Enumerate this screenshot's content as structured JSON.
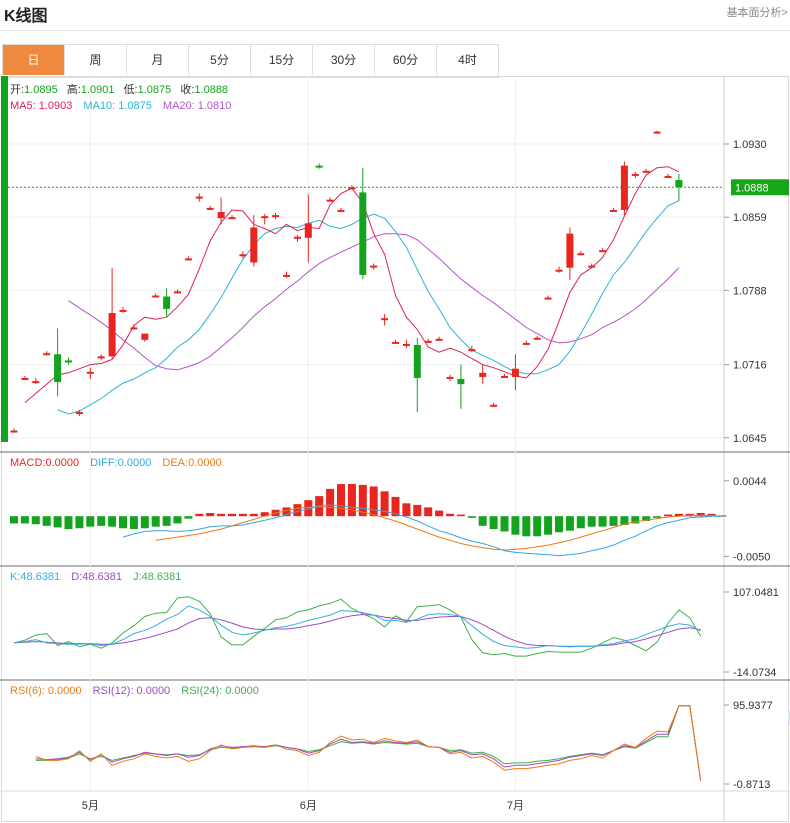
{
  "header": {
    "title": "K线图",
    "link": "基本面分析>"
  },
  "tabs": [
    "日",
    "周",
    "月",
    "5分",
    "15分",
    "30分",
    "60分",
    "4时"
  ],
  "active_tab": 0,
  "colors": {
    "up": "#e8251e",
    "down": "#14a31e",
    "ma5": "#e0205a",
    "ma10": "#2ab4d8",
    "ma20": "#b255c8",
    "diff": "#33a8e0",
    "dea": "#ee7a16",
    "k": "#35aee0",
    "d": "#9a4ec0",
    "j": "#3fb04a",
    "rsi6": "#ee7a16",
    "rsi12": "#9a4ec0",
    "rsi24": "#3fb04a",
    "current": "#19a519"
  },
  "info": {
    "open_label": "开:",
    "open": "1.0895",
    "high_label": "高:",
    "high": "1.0901",
    "low_label": "低:",
    "low": "1.0875",
    "close_label": "收:",
    "close": "1.0888",
    "ma5_label": "MA5:",
    "ma5": "1.0903",
    "ma10_label": "MA10:",
    "ma10": "1.0875",
    "ma20_label": "MA20:",
    "ma20": "1.0810"
  },
  "current_price": "1.0888",
  "macd_legend": {
    "macd_label": "MACD:",
    "macd": "0.0000",
    "diff_label": "DIFF:",
    "diff": "0.0000",
    "dea_label": "DEA:",
    "dea": "0.0000"
  },
  "kdj_legend": {
    "k_label": "K:",
    "k": "48.6381",
    "d_label": "D:",
    "d": "48.6381",
    "j_label": "J:",
    "j": "48.6381"
  },
  "rsi_legend": {
    "rsi6_label": "RSI(6):",
    "rsi6": "0.0000",
    "rsi12_label": "RSI(12):",
    "rsi12": "0.0000",
    "rsi24_label": "RSI(24):",
    "rsi24": "0.0000"
  },
  "chart_data": [
    {
      "type": "candlestick",
      "title": "K线图",
      "y_ticks": [
        "1.0930",
        "1.0859",
        "1.0788",
        "1.0716",
        "1.0645"
      ],
      "ylim": [
        1.0637,
        1.0962
      ],
      "x_ticks": [
        {
          "label": "5月",
          "index": 7
        },
        {
          "label": "6月",
          "index": 27
        },
        {
          "label": "7月",
          "index": 46
        }
      ],
      "candles": [
        {
          "o": 1.0652,
          "h": 1.0654,
          "l": 1.065,
          "c": 1.0652
        },
        {
          "o": 1.0703,
          "h": 1.0705,
          "l": 1.0701,
          "c": 1.0703
        },
        {
          "o": 1.07,
          "h": 1.0703,
          "l": 1.0697,
          "c": 1.07
        },
        {
          "o": 1.0727,
          "h": 1.0729,
          "l": 1.0725,
          "c": 1.0727
        },
        {
          "o": 1.0726,
          "h": 1.0751,
          "l": 1.0685,
          "c": 1.0699
        },
        {
          "o": 1.072,
          "h": 1.0723,
          "l": 1.0716,
          "c": 1.0719
        },
        {
          "o": 1.0668,
          "h": 1.0672,
          "l": 1.0666,
          "c": 1.067
        },
        {
          "o": 1.0708,
          "h": 1.0713,
          "l": 1.0702,
          "c": 1.0709
        },
        {
          "o": 1.0722,
          "h": 1.0726,
          "l": 1.072,
          "c": 1.0724
        },
        {
          "o": 1.0724,
          "h": 1.081,
          "l": 1.0722,
          "c": 1.0766
        },
        {
          "o": 1.0769,
          "h": 1.0772,
          "l": 1.0766,
          "c": 1.0769
        },
        {
          "o": 1.0752,
          "h": 1.0755,
          "l": 1.075,
          "c": 1.0752
        },
        {
          "o": 1.074,
          "h": 1.0746,
          "l": 1.0738,
          "c": 1.0746
        },
        {
          "o": 1.0783,
          "h": 1.0785,
          "l": 1.0781,
          "c": 1.0783
        },
        {
          "o": 1.0782,
          "h": 1.079,
          "l": 1.0762,
          "c": 1.077
        },
        {
          "o": 1.0787,
          "h": 1.0789,
          "l": 1.0785,
          "c": 1.0787
        },
        {
          "o": 1.0819,
          "h": 1.0821,
          "l": 1.0817,
          "c": 1.0819
        },
        {
          "o": 1.0879,
          "h": 1.0882,
          "l": 1.0874,
          "c": 1.0879
        },
        {
          "o": 1.0868,
          "h": 1.087,
          "l": 1.0866,
          "c": 1.0868
        },
        {
          "o": 1.0858,
          "h": 1.0878,
          "l": 1.0852,
          "c": 1.0864
        },
        {
          "o": 1.0859,
          "h": 1.0861,
          "l": 1.0857,
          "c": 1.0859
        },
        {
          "o": 1.0823,
          "h": 1.0826,
          "l": 1.0819,
          "c": 1.0823
        },
        {
          "o": 1.0815,
          "h": 1.0861,
          "l": 1.0811,
          "c": 1.0849
        },
        {
          "o": 1.0859,
          "h": 1.0862,
          "l": 1.0852,
          "c": 1.086
        },
        {
          "o": 1.086,
          "h": 1.0863,
          "l": 1.0857,
          "c": 1.0861
        },
        {
          "o": 1.0803,
          "h": 1.0806,
          "l": 1.08,
          "c": 1.0803
        },
        {
          "o": 1.0838,
          "h": 1.0842,
          "l": 1.0835,
          "c": 1.084
        },
        {
          "o": 1.0839,
          "h": 1.0881,
          "l": 1.0815,
          "c": 1.0853
        },
        {
          "o": 1.0909,
          "h": 1.0911,
          "l": 1.0906,
          "c": 1.0908
        },
        {
          "o": 1.0876,
          "h": 1.0878,
          "l": 1.0874,
          "c": 1.0876
        },
        {
          "o": 1.0866,
          "h": 1.0868,
          "l": 1.0864,
          "c": 1.0866
        },
        {
          "o": 1.0888,
          "h": 1.089,
          "l": 1.0886,
          "c": 1.0888
        },
        {
          "o": 1.0883,
          "h": 1.0907,
          "l": 1.0799,
          "c": 1.0803
        },
        {
          "o": 1.0812,
          "h": 1.0814,
          "l": 1.0808,
          "c": 1.0812
        },
        {
          "o": 1.0761,
          "h": 1.0765,
          "l": 1.0754,
          "c": 1.0761
        },
        {
          "o": 1.0738,
          "h": 1.074,
          "l": 1.0736,
          "c": 1.0738
        },
        {
          "o": 1.0736,
          "h": 1.074,
          "l": 1.0732,
          "c": 1.0736
        },
        {
          "o": 1.0735,
          "h": 1.0742,
          "l": 1.067,
          "c": 1.0703
        },
        {
          "o": 1.0739,
          "h": 1.0741,
          "l": 1.0737,
          "c": 1.0739
        },
        {
          "o": 1.0741,
          "h": 1.0743,
          "l": 1.0739,
          "c": 1.0741
        },
        {
          "o": 1.0703,
          "h": 1.0706,
          "l": 1.07,
          "c": 1.0704
        },
        {
          "o": 1.0702,
          "h": 1.0716,
          "l": 1.0673,
          "c": 1.0697
        },
        {
          "o": 1.0731,
          "h": 1.0734,
          "l": 1.0728,
          "c": 1.0731
        },
        {
          "o": 1.0704,
          "h": 1.0716,
          "l": 1.0697,
          "c": 1.0708
        },
        {
          "o": 1.0677,
          "h": 1.0679,
          "l": 1.0675,
          "c": 1.0677
        },
        {
          "o": 1.0705,
          "h": 1.0707,
          "l": 1.0703,
          "c": 1.0705
        },
        {
          "o": 1.0704,
          "h": 1.0726,
          "l": 1.0691,
          "c": 1.0712
        },
        {
          "o": 1.0737,
          "h": 1.0739,
          "l": 1.0735,
          "c": 1.0737
        },
        {
          "o": 1.0742,
          "h": 1.0744,
          "l": 1.074,
          "c": 1.0742
        },
        {
          "o": 1.0781,
          "h": 1.0783,
          "l": 1.0779,
          "c": 1.0781
        },
        {
          "o": 1.0808,
          "h": 1.0811,
          "l": 1.0805,
          "c": 1.0808
        },
        {
          "o": 1.081,
          "h": 1.0849,
          "l": 1.0798,
          "c": 1.0843
        },
        {
          "o": 1.0824,
          "h": 1.0826,
          "l": 1.0822,
          "c": 1.0824
        },
        {
          "o": 1.0812,
          "h": 1.0814,
          "l": 1.081,
          "c": 1.0812
        },
        {
          "o": 1.0827,
          "h": 1.0829,
          "l": 1.0825,
          "c": 1.0827
        },
        {
          "o": 1.0866,
          "h": 1.0868,
          "l": 1.0864,
          "c": 1.0866
        },
        {
          "o": 1.0866,
          "h": 1.0913,
          "l": 1.0861,
          "c": 1.0909
        },
        {
          "o": 1.0901,
          "h": 1.0903,
          "l": 1.0897,
          "c": 1.0901
        },
        {
          "o": 1.0904,
          "h": 1.0906,
          "l": 1.0902,
          "c": 1.0904
        },
        {
          "o": 1.0942,
          "h": 1.0943,
          "l": 1.094,
          "c": 1.0942
        },
        {
          "o": 1.0899,
          "h": 1.0901,
          "l": 1.0897,
          "c": 1.0899
        },
        {
          "o": 1.0895,
          "h": 1.0901,
          "l": 1.0875,
          "c": 1.0888
        }
      ],
      "ma5": [
        1.0679,
        1.0688,
        1.0697,
        1.0706,
        1.0708,
        1.0712,
        1.0716,
        1.0717,
        1.0721,
        1.0735,
        1.0754,
        1.0762,
        1.076,
        1.0762,
        1.0772,
        1.0784,
        1.0809,
        1.0836,
        1.0854,
        1.0866,
        1.0865,
        1.0852,
        1.0848,
        1.0843,
        1.0852,
        1.0846,
        1.0849,
        1.0848,
        1.0871,
        1.0882,
        1.0887,
        1.0873,
        1.0843,
        1.0823,
        1.0783,
        1.0762,
        1.075,
        1.0733,
        1.0728,
        1.0732,
        1.0728,
        1.0722,
        1.0716,
        1.0713,
        1.0709,
        1.0705,
        1.0703,
        1.0714,
        1.0731,
        1.0758,
        1.0786,
        1.0803,
        1.081,
        1.082,
        1.0837,
        1.086,
        1.0882,
        1.09,
        1.0907,
        1.0908,
        1.0903
      ],
      "ma10": [
        1.0672,
        1.0668,
        1.0671,
        1.0677,
        1.0683,
        1.0691,
        1.0698,
        1.0702,
        1.0708,
        1.0713,
        1.0722,
        1.0733,
        1.074,
        1.075,
        1.0765,
        1.0781,
        1.08,
        1.0818,
        1.0832,
        1.0843,
        1.0848,
        1.085,
        1.0849,
        1.0853,
        1.0856,
        1.085,
        1.0848,
        1.0852,
        1.0858,
        1.0862,
        1.0858,
        1.0845,
        1.083,
        1.0808,
        1.0787,
        1.077,
        1.0752,
        1.074,
        1.073,
        1.0725,
        1.072,
        1.0714,
        1.0709,
        1.0707,
        1.0707,
        1.0711,
        1.0716,
        1.0729,
        1.0746,
        1.0765,
        1.0785,
        1.0803,
        1.0815,
        1.083,
        1.0845,
        1.0858,
        1.087,
        1.0875
      ],
      "ma20": [
        1.0778,
        1.0771,
        1.0764,
        1.0757,
        1.0749,
        1.074,
        1.0732,
        1.0723,
        1.0715,
        1.0712,
        1.0711,
        1.0714,
        1.0718,
        1.0724,
        1.0733,
        1.0742,
        1.0752,
        1.0763,
        1.0772,
        1.078,
        1.0789,
        1.0797,
        1.0806,
        1.0814,
        1.082,
        1.0825,
        1.083,
        1.0835,
        1.084,
        1.0843,
        1.0843,
        1.0842,
        1.0837,
        1.0828,
        1.0819,
        1.0809,
        1.0799,
        1.0791,
        1.0783,
        1.0776,
        1.0768,
        1.076,
        1.0752,
        1.0746,
        1.074,
        1.0737,
        1.0738,
        1.0741,
        1.0745,
        1.0752,
        1.0757,
        1.0763,
        1.077,
        1.0779,
        1.0789,
        1.0799,
        1.081
      ]
    },
    {
      "type": "macd",
      "y_ticks": [
        "0.0044",
        "-0.0050"
      ],
      "ylim": [
        -0.0052,
        0.0055
      ],
      "macd": [
        -0.0009,
        -0.0009,
        -0.001,
        -0.0012,
        -0.0014,
        -0.0016,
        -0.0015,
        -0.0013,
        -0.0012,
        -0.0013,
        -0.0015,
        -0.0016,
        -0.0015,
        -0.0013,
        -0.0012,
        -0.0009,
        -0.0003,
        0.0003,
        0.0004,
        0.0003,
        0.0003,
        0.0003,
        0.0003,
        0.0005,
        0.0008,
        0.0011,
        0.0015,
        0.002,
        0.0025,
        0.0034,
        0.004,
        0.004,
        0.0039,
        0.0037,
        0.0031,
        0.0024,
        0.0016,
        0.0014,
        0.0011,
        0.0007,
        0.0003,
        0.0002,
        -0.0002,
        -0.0012,
        -0.0016,
        -0.0019,
        -0.0023,
        -0.0025,
        -0.0025,
        -0.0023,
        -0.002,
        -0.0018,
        -0.0015,
        -0.0013,
        -0.0013,
        -0.0012,
        -0.0011,
        -0.0009,
        -0.0006,
        -0.0002,
        0.0002,
        0.0003,
        0.0003,
        0.0004,
        0.0003,
        0.0001
      ],
      "diff": [
        -0.0026,
        -0.0022,
        -0.0019,
        -0.0018,
        -0.0018,
        -0.0019,
        -0.0018,
        -0.0016,
        -0.0013,
        -0.0012,
        -0.0012,
        -0.0011,
        -0.0008,
        -0.0005,
        -0.0002,
        0.0002,
        0.0006,
        0.0009,
        0.0013,
        0.0014,
        0.0013,
        0.0011,
        0.001,
        0.0008,
        0.0006,
        0.0003,
        -0.0001,
        -0.0006,
        -0.0012,
        -0.0018,
        -0.0022,
        -0.0027,
        -0.0031,
        -0.0034,
        -0.0038,
        -0.0043,
        -0.0045,
        -0.0046,
        -0.0047,
        -0.0048,
        -0.0049,
        -0.0048,
        -0.0046,
        -0.0043,
        -0.004,
        -0.0036,
        -0.003,
        -0.0025,
        -0.0018,
        -0.0012,
        -0.0008,
        -0.0005,
        -0.0002,
        -0.0001,
        0.0,
        0.0
      ],
      "dea": [
        -0.003,
        -0.0028,
        -0.0026,
        -0.0024,
        -0.0022,
        -0.0019,
        -0.0016,
        -0.0012,
        -0.0008,
        -0.0004,
        0.0,
        0.0004,
        0.0007,
        0.001,
        0.0011,
        0.0012,
        0.0011,
        0.001,
        0.0008,
        0.0005,
        0.0002,
        -0.0002,
        -0.0006,
        -0.0011,
        -0.0016,
        -0.0021,
        -0.0026,
        -0.003,
        -0.0034,
        -0.0037,
        -0.0039,
        -0.0041,
        -0.0042,
        -0.0041,
        -0.004,
        -0.0038,
        -0.0036,
        -0.0033,
        -0.003,
        -0.0026,
        -0.0022,
        -0.0018,
        -0.0014,
        -0.001,
        -0.0007,
        -0.0005,
        -0.0003,
        -0.0001,
        0.0,
        0.0001,
        0.0001,
        0.0001,
        0.0
      ]
    },
    {
      "type": "line",
      "name": "KDJ",
      "y_ticks": [
        "107.0481",
        "-14.0734"
      ],
      "ylim": [
        -14.0734,
        107.0481
      ],
      "k": [
        30,
        32,
        35,
        30,
        29,
        28,
        28,
        29,
        26,
        28,
        35,
        44,
        49,
        56,
        66,
        73,
        86,
        80,
        70,
        57,
        46,
        42,
        45,
        49,
        53,
        55,
        59,
        64,
        68,
        72,
        79,
        78,
        76,
        72,
        64,
        64,
        61,
        66,
        73,
        74,
        73,
        70,
        56,
        43,
        32,
        26,
        24,
        22,
        23,
        26,
        25,
        24,
        25,
        25,
        27,
        29,
        33,
        36,
        43,
        49,
        55,
        59,
        57,
        48
      ],
      "d": [
        30,
        31,
        32,
        31,
        30,
        29,
        29,
        29,
        28,
        28,
        30,
        33,
        37,
        41,
        46,
        51,
        60,
        67,
        68,
        65,
        60,
        54,
        51,
        50,
        51,
        51,
        53,
        56,
        59,
        63,
        68,
        71,
        73,
        72,
        69,
        67,
        64,
        64,
        67,
        69,
        70,
        70,
        65,
        58,
        49,
        40,
        33,
        28,
        26,
        26,
        25,
        25,
        25,
        25,
        26,
        27,
        30,
        32,
        36,
        41,
        46,
        51,
        53,
        50
      ],
      "j": [
        30,
        34,
        42,
        44,
        26,
        32,
        24,
        28,
        22,
        30,
        45,
        56,
        70,
        75,
        76,
        98,
        100,
        93,
        74,
        39,
        27,
        27,
        40,
        52,
        65,
        68,
        77,
        80,
        86,
        90,
        96,
        82,
        74,
        67,
        54,
        71,
        62,
        85,
        86,
        88,
        80,
        69,
        35,
        15,
        12,
        14,
        10,
        10,
        14,
        17,
        16,
        16,
        16,
        22,
        30,
        38,
        34,
        26,
        18,
        31,
        60,
        80,
        68,
        40
      ]
    },
    {
      "type": "line",
      "name": "RSI",
      "y_ticks": [
        "95.9377",
        "-0.8713"
      ],
      "ylim": [
        -0.8713,
        95.9377
      ],
      "rsi6": [
        33,
        28,
        28,
        30,
        40,
        27,
        36,
        22,
        27,
        30,
        36,
        33,
        31,
        33,
        27,
        30,
        40,
        47,
        42,
        44,
        45,
        44,
        47,
        42,
        40,
        34,
        38,
        50,
        58,
        53,
        54,
        50,
        55,
        52,
        50,
        53,
        45,
        44,
        36,
        38,
        31,
        33,
        26,
        16,
        18,
        18,
        20,
        22,
        24,
        28,
        30,
        34,
        31,
        40,
        48,
        44,
        55,
        64,
        63,
        95,
        95,
        3
      ],
      "rsi12": [
        30,
        29,
        30,
        32,
        38,
        29,
        35,
        26,
        30,
        33,
        38,
        36,
        34,
        36,
        32,
        34,
        42,
        46,
        44,
        45,
        46,
        45,
        47,
        44,
        42,
        37,
        40,
        48,
        54,
        50,
        51,
        49,
        52,
        50,
        49,
        51,
        45,
        44,
        38,
        40,
        35,
        36,
        30,
        20,
        22,
        22,
        24,
        26,
        28,
        32,
        34,
        36,
        34,
        40,
        46,
        44,
        52,
        60,
        60,
        95,
        95,
        3
      ],
      "rsi24": [
        28,
        28,
        29,
        31,
        36,
        30,
        33,
        28,
        31,
        34,
        37,
        36,
        35,
        36,
        34,
        35,
        41,
        44,
        43,
        44,
        45,
        44,
        46,
        44,
        42,
        39,
        41,
        46,
        51,
        49,
        50,
        48,
        50,
        49,
        48,
        49,
        45,
        44,
        40,
        41,
        37,
        38,
        33,
        24,
        25,
        25,
        27,
        28,
        30,
        33,
        35,
        37,
        35,
        40,
        45,
        43,
        50,
        57,
        57,
        95,
        95,
        3
      ]
    }
  ]
}
